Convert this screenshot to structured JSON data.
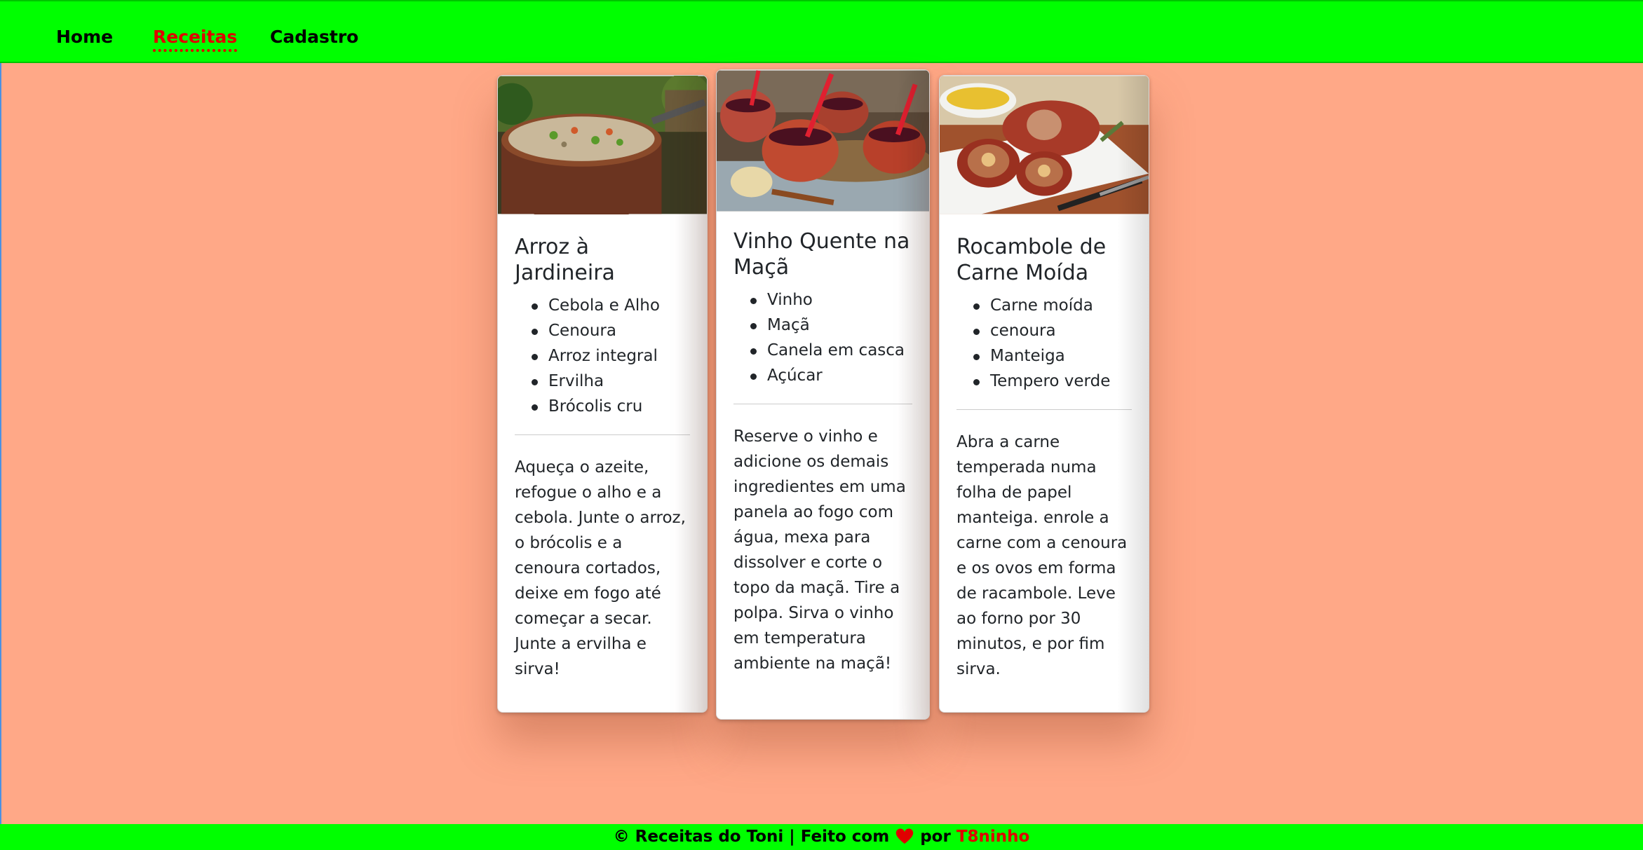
{
  "nav": {
    "items": [
      {
        "label": "Home",
        "active": false
      },
      {
        "label": "Receitas",
        "active": true
      },
      {
        "label": "Cadastro",
        "active": false
      }
    ]
  },
  "cards": [
    {
      "title": "Arroz à Jardineira",
      "image_icon": "rice-pot-photo",
      "ingredients": [
        "Cebola e Alho",
        "Cenoura",
        "Arroz integral",
        "Ervilha",
        "Brócolis cru"
      ],
      "instructions": "Aqueça o azeite, refogue o alho e a cebola. Junte o arroz, o brócolis e a cenoura cortados, deixe em fogo até começar a secar. Junte a ervilha e sirva!"
    },
    {
      "title": "Vinho Quente na Maçã",
      "image_icon": "mulled-wine-apple-photo",
      "ingredients": [
        "Vinho",
        "Maçã",
        "Canela em casca",
        "Açúcar"
      ],
      "instructions": "Reserve o vinho e adicione os demais ingredientes em uma panela ao fogo com água, mexa para dissolver e corte o topo da maçã. Tire a polpa. Sirva o vinho em temperatura ambiente na maçã!"
    },
    {
      "title": "Rocambole de Carne Moída",
      "image_icon": "meat-roll-photo",
      "ingredients": [
        "Carne moída",
        "cenoura",
        "Manteiga",
        "Tempero verde"
      ],
      "instructions": "Abra a carne temperada numa folha de papel manteiga. enrole a carne com a cenoura e os ovos em forma de racambole. Leve ao forno por 30 minutos, e por fim sirva."
    }
  ],
  "footer": {
    "prefix": "© Receitas do Toni | Feito com",
    "middle": "por",
    "author": "T8ninho",
    "heart_icon": "heart-icon"
  },
  "colors": {
    "navbar": "#00FF00",
    "background": "#FFA887",
    "accent": "#E00000"
  }
}
